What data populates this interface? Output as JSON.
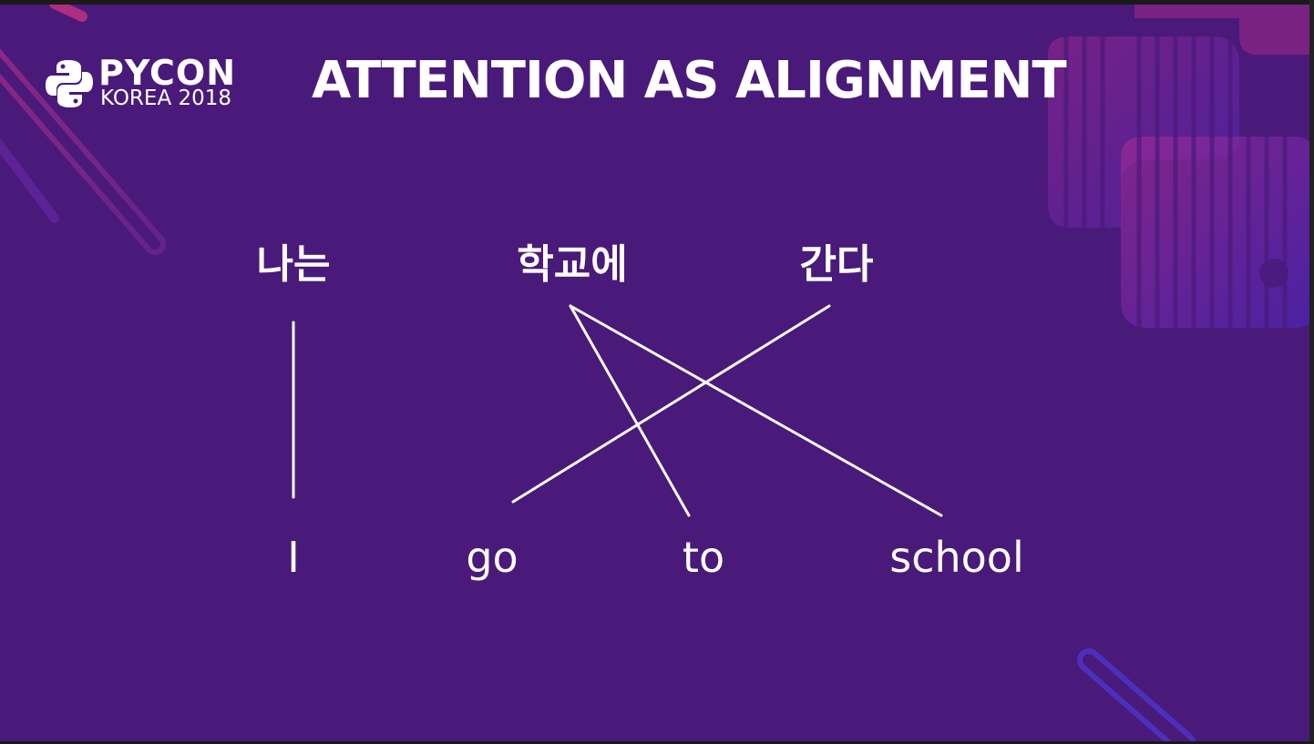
{
  "logo": {
    "main": "PYCON",
    "sub": "KOREA 2018"
  },
  "title": "ATTENTION AS ALIGNMENT",
  "diagram": {
    "source_words": [
      "나는",
      "학교에",
      "간다"
    ],
    "target_words": [
      "I",
      "go",
      "to",
      "school"
    ],
    "alignments": [
      {
        "source": "나는",
        "target": "I"
      },
      {
        "source": "학교에",
        "target": "to"
      },
      {
        "source": "학교에",
        "target": "school"
      },
      {
        "source": "간다",
        "target": "go"
      }
    ]
  },
  "colors": {
    "background": "#4a1a7a",
    "text": "#ffffff",
    "accent_pink": "#d23a8a",
    "accent_blue": "#4a3ad8"
  }
}
